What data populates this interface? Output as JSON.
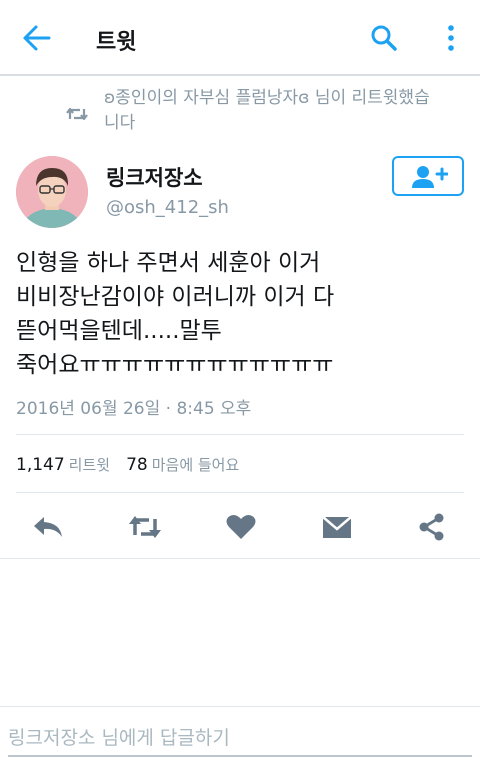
{
  "header": {
    "title": "트윗"
  },
  "retweet_context": {
    "text": "ʚ종인이의 자부심 플럼낭자ɞ 님이 리트윗했습니다"
  },
  "author": {
    "name": "링크저장소",
    "handle": "@osh_412_sh"
  },
  "tweet": {
    "lines": [
      "인형을 하나 주면서 세훈아 이거",
      "비비장난감이야 이러니까 이거 다",
      "뜯어먹을텐데.....말투",
      "죽어요ㅠㅠㅠㅠㅠㅠㅠㅠㅠㅠㅠㅠ"
    ],
    "timestamp": "2016년 06월 26일 · 8:45 오후"
  },
  "stats": {
    "retweets_count": "1,147",
    "retweets_label": "리트윗",
    "likes_count": "78",
    "likes_label": "마음에 들어요"
  },
  "reply": {
    "placeholder": "링크저장소 님에게 답글하기"
  },
  "colors": {
    "accent": "#1da1f2",
    "icon_gray": "#657786",
    "secondary_text": "#8899a6"
  },
  "icons": {
    "back": "arrow-left-icon",
    "search": "search-icon",
    "more": "more-vertical-icon",
    "retweet_context": "retweet-icon",
    "follow": "add-user-icon",
    "reply": "reply-icon",
    "retweet": "retweet-icon",
    "like": "heart-icon",
    "dm": "envelope-icon",
    "share": "share-icon"
  }
}
